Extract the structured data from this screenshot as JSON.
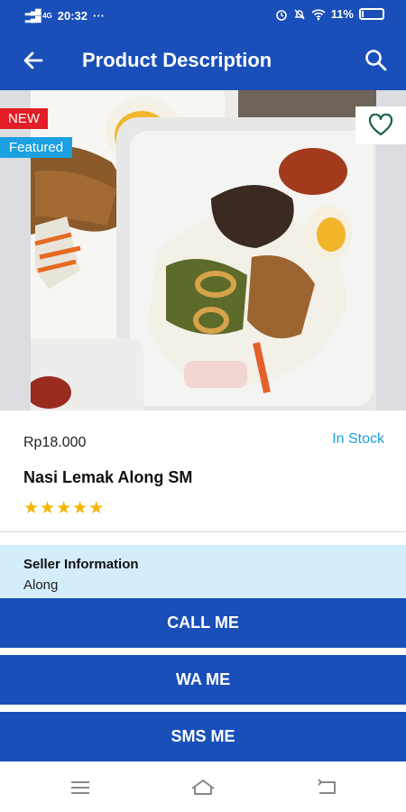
{
  "status": {
    "signal_label": "4G",
    "time": "20:32",
    "dots": "···",
    "battery": "11%",
    "battery_level": 0.11
  },
  "app_bar": {
    "title": "Product Description"
  },
  "product": {
    "badge_new": "NEW",
    "badge_featured": "Featured",
    "price": "Rp18.000",
    "stock": "In Stock",
    "name": "Nasi Lemak Along SM",
    "rating": 5,
    "rating_max": 5
  },
  "seller": {
    "label": "Seller Information",
    "name": "Along"
  },
  "actions": {
    "call": "CALL ME",
    "wa": "WA ME",
    "sms": "SMS ME"
  },
  "colors": {
    "primary": "#1a4fba",
    "new_badge": "#e21d25",
    "featured_badge": "#1ba0e2",
    "seller_bg": "#d4edfa",
    "star": "#f5b400"
  }
}
